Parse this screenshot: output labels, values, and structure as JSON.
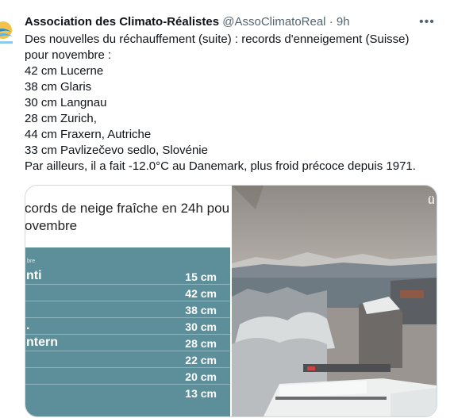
{
  "tweet": {
    "author_name": "Association des Climato-Réalistes",
    "handle": "@AssoClimatoReal",
    "separator": "·",
    "time": "9h",
    "more_icon": "more-dots-icon",
    "lines": [
      "Des nouvelles du réchauffement (suite) : records d'enneigement (Suisse)",
      "pour novembre :",
      "42 cm Lucerne",
      "38 cm Glaris",
      "30 cm Langnau",
      "28 cm Zurich,",
      "44 cm Fraxern, Autriche",
      "33 cm Pavlizečevo sedlo, Slovénie",
      "Par ailleurs, il a fait -12.0°C au Danemark, plus froid précoce depuis 1971."
    ]
  },
  "media": {
    "left_image": {
      "title_line1": "cords de neige fraîche en 24h pou",
      "title_line2": "ovembre",
      "header_label": "bre",
      "rows": [
        {
          "name": "nti",
          "value": "15 cm"
        },
        {
          "name": "",
          "value": "42 cm"
        },
        {
          "name": "",
          "value": "38 cm"
        },
        {
          "name": ".",
          "value": "30 cm"
        },
        {
          "name": "ntern",
          "value": "28 cm"
        },
        {
          "name": "",
          "value": "22 cm"
        },
        {
          "name": "",
          "value": "20 cm"
        },
        {
          "name": "",
          "value": "13 cm"
        }
      ]
    },
    "right_image": {
      "logo_text": "ü",
      "description_icon": "webcam-snow-scene"
    }
  },
  "colors": {
    "table_teal": "#5d8f9a",
    "text_primary": "#0f1419",
    "text_secondary": "#536471"
  }
}
